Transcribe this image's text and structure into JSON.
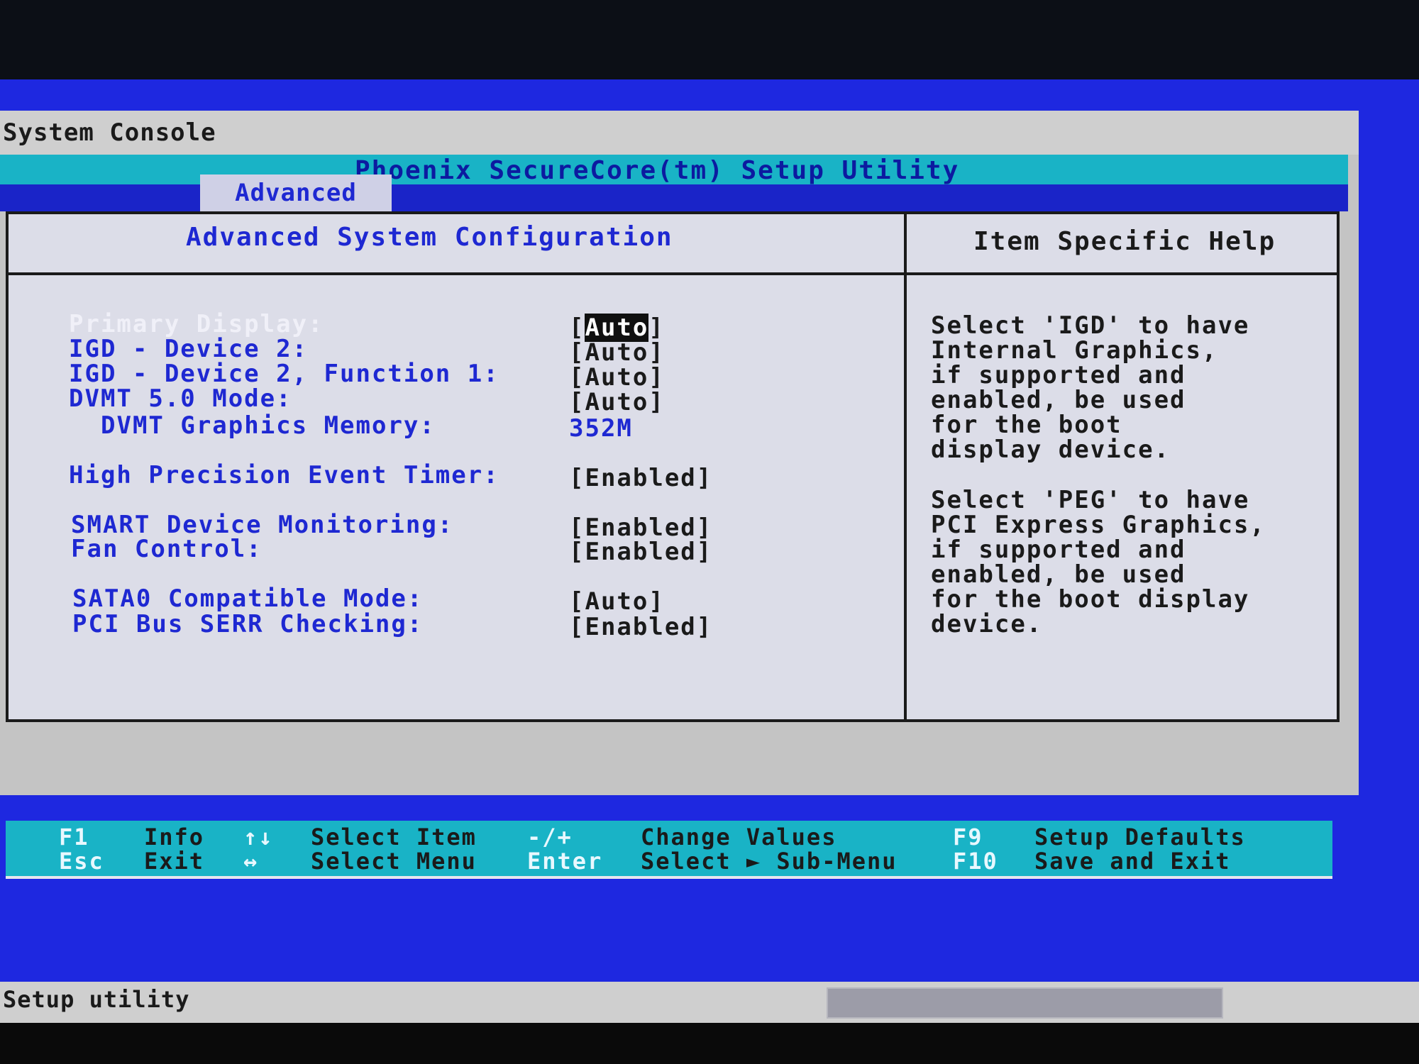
{
  "window": {
    "title": "System Console"
  },
  "utility": {
    "title": "Phoenix SecureCore(tm) Setup Utility"
  },
  "menu": {
    "active_tab": "Advanced"
  },
  "main": {
    "header": "Advanced System Configuration",
    "settings": [
      {
        "label": "Primary Display:",
        "value": "Auto",
        "bracket_open": "[",
        "bracket_close": "]"
      },
      {
        "label": "IGD - Device 2:",
        "value": "[Auto]"
      },
      {
        "label": "IGD - Device 2, Function 1:",
        "value": "[Auto]"
      },
      {
        "label": "DVMT 5.0 Mode:",
        "value": "[Auto]"
      },
      {
        "label": "DVMT Graphics Memory:",
        "value": "352M"
      },
      {
        "label": "High Precision Event Timer:",
        "value": "[Enabled]"
      },
      {
        "label": "SMART Device Monitoring:",
        "value": "[Enabled]"
      },
      {
        "label": "Fan Control:",
        "value": "[Enabled]"
      },
      {
        "label": "SATA0 Compatible Mode:",
        "value": "[Auto]"
      },
      {
        "label": "PCI Bus SERR Checking:",
        "value": "[Enabled]"
      }
    ]
  },
  "help": {
    "header": "Item Specific Help",
    "paragraph1": "Select 'IGD' to have\nInternal Graphics,\nif supported and\nenabled, be used\nfor the boot\ndisplay device.",
    "paragraph2": "Select 'PEG' to have\nPCI Express Graphics,\nif supported and\nenabled, be used\nfor the boot display\ndevice."
  },
  "keys": {
    "f1": "F1",
    "f1_desc": "Info",
    "esc": "Esc",
    "esc_desc": "Exit",
    "updown": "↑↓",
    "updown_desc": "Select Item",
    "leftright": "↔",
    "leftright_desc": "Select Menu",
    "plusminus": "-/+",
    "plusminus_desc": "Change Values",
    "enter": "Enter",
    "enter_desc": "Select ► Sub-Menu",
    "f9": "F9",
    "f9_desc": "Setup Defaults",
    "f10": "F10",
    "f10_desc": "Save and Exit"
  },
  "footer": {
    "status_text": "Setup utility"
  },
  "colors": {
    "background_blue": "#1e28e0",
    "accent_cyan": "#19b3c6",
    "label_blue": "#1e28d2"
  }
}
